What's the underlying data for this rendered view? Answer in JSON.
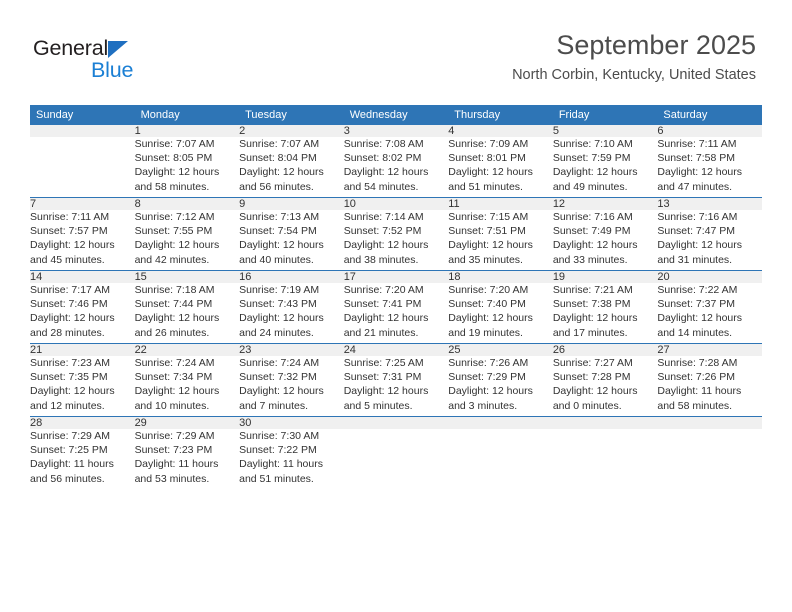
{
  "brand": {
    "name_part1": "General",
    "name_part2": "Blue",
    "primary_color": "#2e75b6",
    "accent_color": "#1b7fd4",
    "triangle_icon": "triangle-icon"
  },
  "header": {
    "month_title": "September 2025",
    "location": "North Corbin, Kentucky, United States"
  },
  "calendar": {
    "weekday_headers": [
      "Sunday",
      "Monday",
      "Tuesday",
      "Wednesday",
      "Thursday",
      "Friday",
      "Saturday"
    ],
    "weeks": [
      [
        {
          "day": "",
          "sunrise": "",
          "sunset": "",
          "daylight_line1": "",
          "daylight_line2": "",
          "empty": true
        },
        {
          "day": "1",
          "sunrise": "Sunrise: 7:07 AM",
          "sunset": "Sunset: 8:05 PM",
          "daylight_line1": "Daylight: 12 hours",
          "daylight_line2": "and 58 minutes.",
          "empty": false
        },
        {
          "day": "2",
          "sunrise": "Sunrise: 7:07 AM",
          "sunset": "Sunset: 8:04 PM",
          "daylight_line1": "Daylight: 12 hours",
          "daylight_line2": "and 56 minutes.",
          "empty": false
        },
        {
          "day": "3",
          "sunrise": "Sunrise: 7:08 AM",
          "sunset": "Sunset: 8:02 PM",
          "daylight_line1": "Daylight: 12 hours",
          "daylight_line2": "and 54 minutes.",
          "empty": false
        },
        {
          "day": "4",
          "sunrise": "Sunrise: 7:09 AM",
          "sunset": "Sunset: 8:01 PM",
          "daylight_line1": "Daylight: 12 hours",
          "daylight_line2": "and 51 minutes.",
          "empty": false
        },
        {
          "day": "5",
          "sunrise": "Sunrise: 7:10 AM",
          "sunset": "Sunset: 7:59 PM",
          "daylight_line1": "Daylight: 12 hours",
          "daylight_line2": "and 49 minutes.",
          "empty": false
        },
        {
          "day": "6",
          "sunrise": "Sunrise: 7:11 AM",
          "sunset": "Sunset: 7:58 PM",
          "daylight_line1": "Daylight: 12 hours",
          "daylight_line2": "and 47 minutes.",
          "empty": false
        }
      ],
      [
        {
          "day": "7",
          "sunrise": "Sunrise: 7:11 AM",
          "sunset": "Sunset: 7:57 PM",
          "daylight_line1": "Daylight: 12 hours",
          "daylight_line2": "and 45 minutes.",
          "empty": false
        },
        {
          "day": "8",
          "sunrise": "Sunrise: 7:12 AM",
          "sunset": "Sunset: 7:55 PM",
          "daylight_line1": "Daylight: 12 hours",
          "daylight_line2": "and 42 minutes.",
          "empty": false
        },
        {
          "day": "9",
          "sunrise": "Sunrise: 7:13 AM",
          "sunset": "Sunset: 7:54 PM",
          "daylight_line1": "Daylight: 12 hours",
          "daylight_line2": "and 40 minutes.",
          "empty": false
        },
        {
          "day": "10",
          "sunrise": "Sunrise: 7:14 AM",
          "sunset": "Sunset: 7:52 PM",
          "daylight_line1": "Daylight: 12 hours",
          "daylight_line2": "and 38 minutes.",
          "empty": false
        },
        {
          "day": "11",
          "sunrise": "Sunrise: 7:15 AM",
          "sunset": "Sunset: 7:51 PM",
          "daylight_line1": "Daylight: 12 hours",
          "daylight_line2": "and 35 minutes.",
          "empty": false
        },
        {
          "day": "12",
          "sunrise": "Sunrise: 7:16 AM",
          "sunset": "Sunset: 7:49 PM",
          "daylight_line1": "Daylight: 12 hours",
          "daylight_line2": "and 33 minutes.",
          "empty": false
        },
        {
          "day": "13",
          "sunrise": "Sunrise: 7:16 AM",
          "sunset": "Sunset: 7:47 PM",
          "daylight_line1": "Daylight: 12 hours",
          "daylight_line2": "and 31 minutes.",
          "empty": false
        }
      ],
      [
        {
          "day": "14",
          "sunrise": "Sunrise: 7:17 AM",
          "sunset": "Sunset: 7:46 PM",
          "daylight_line1": "Daylight: 12 hours",
          "daylight_line2": "and 28 minutes.",
          "empty": false
        },
        {
          "day": "15",
          "sunrise": "Sunrise: 7:18 AM",
          "sunset": "Sunset: 7:44 PM",
          "daylight_line1": "Daylight: 12 hours",
          "daylight_line2": "and 26 minutes.",
          "empty": false
        },
        {
          "day": "16",
          "sunrise": "Sunrise: 7:19 AM",
          "sunset": "Sunset: 7:43 PM",
          "daylight_line1": "Daylight: 12 hours",
          "daylight_line2": "and 24 minutes.",
          "empty": false
        },
        {
          "day": "17",
          "sunrise": "Sunrise: 7:20 AM",
          "sunset": "Sunset: 7:41 PM",
          "daylight_line1": "Daylight: 12 hours",
          "daylight_line2": "and 21 minutes.",
          "empty": false
        },
        {
          "day": "18",
          "sunrise": "Sunrise: 7:20 AM",
          "sunset": "Sunset: 7:40 PM",
          "daylight_line1": "Daylight: 12 hours",
          "daylight_line2": "and 19 minutes.",
          "empty": false
        },
        {
          "day": "19",
          "sunrise": "Sunrise: 7:21 AM",
          "sunset": "Sunset: 7:38 PM",
          "daylight_line1": "Daylight: 12 hours",
          "daylight_line2": "and 17 minutes.",
          "empty": false
        },
        {
          "day": "20",
          "sunrise": "Sunrise: 7:22 AM",
          "sunset": "Sunset: 7:37 PM",
          "daylight_line1": "Daylight: 12 hours",
          "daylight_line2": "and 14 minutes.",
          "empty": false
        }
      ],
      [
        {
          "day": "21",
          "sunrise": "Sunrise: 7:23 AM",
          "sunset": "Sunset: 7:35 PM",
          "daylight_line1": "Daylight: 12 hours",
          "daylight_line2": "and 12 minutes.",
          "empty": false
        },
        {
          "day": "22",
          "sunrise": "Sunrise: 7:24 AM",
          "sunset": "Sunset: 7:34 PM",
          "daylight_line1": "Daylight: 12 hours",
          "daylight_line2": "and 10 minutes.",
          "empty": false
        },
        {
          "day": "23",
          "sunrise": "Sunrise: 7:24 AM",
          "sunset": "Sunset: 7:32 PM",
          "daylight_line1": "Daylight: 12 hours",
          "daylight_line2": "and 7 minutes.",
          "empty": false
        },
        {
          "day": "24",
          "sunrise": "Sunrise: 7:25 AM",
          "sunset": "Sunset: 7:31 PM",
          "daylight_line1": "Daylight: 12 hours",
          "daylight_line2": "and 5 minutes.",
          "empty": false
        },
        {
          "day": "25",
          "sunrise": "Sunrise: 7:26 AM",
          "sunset": "Sunset: 7:29 PM",
          "daylight_line1": "Daylight: 12 hours",
          "daylight_line2": "and 3 minutes.",
          "empty": false
        },
        {
          "day": "26",
          "sunrise": "Sunrise: 7:27 AM",
          "sunset": "Sunset: 7:28 PM",
          "daylight_line1": "Daylight: 12 hours",
          "daylight_line2": "and 0 minutes.",
          "empty": false
        },
        {
          "day": "27",
          "sunrise": "Sunrise: 7:28 AM",
          "sunset": "Sunset: 7:26 PM",
          "daylight_line1": "Daylight: 11 hours",
          "daylight_line2": "and 58 minutes.",
          "empty": false
        }
      ],
      [
        {
          "day": "28",
          "sunrise": "Sunrise: 7:29 AM",
          "sunset": "Sunset: 7:25 PM",
          "daylight_line1": "Daylight: 11 hours",
          "daylight_line2": "and 56 minutes.",
          "empty": false
        },
        {
          "day": "29",
          "sunrise": "Sunrise: 7:29 AM",
          "sunset": "Sunset: 7:23 PM",
          "daylight_line1": "Daylight: 11 hours",
          "daylight_line2": "and 53 minutes.",
          "empty": false
        },
        {
          "day": "30",
          "sunrise": "Sunrise: 7:30 AM",
          "sunset": "Sunset: 7:22 PM",
          "daylight_line1": "Daylight: 11 hours",
          "daylight_line2": "and 51 minutes.",
          "empty": false
        },
        {
          "day": "",
          "sunrise": "",
          "sunset": "",
          "daylight_line1": "",
          "daylight_line2": "",
          "empty": true
        },
        {
          "day": "",
          "sunrise": "",
          "sunset": "",
          "daylight_line1": "",
          "daylight_line2": "",
          "empty": true
        },
        {
          "day": "",
          "sunrise": "",
          "sunset": "",
          "daylight_line1": "",
          "daylight_line2": "",
          "empty": true
        },
        {
          "day": "",
          "sunrise": "",
          "sunset": "",
          "daylight_line1": "",
          "daylight_line2": "",
          "empty": true
        }
      ]
    ]
  }
}
